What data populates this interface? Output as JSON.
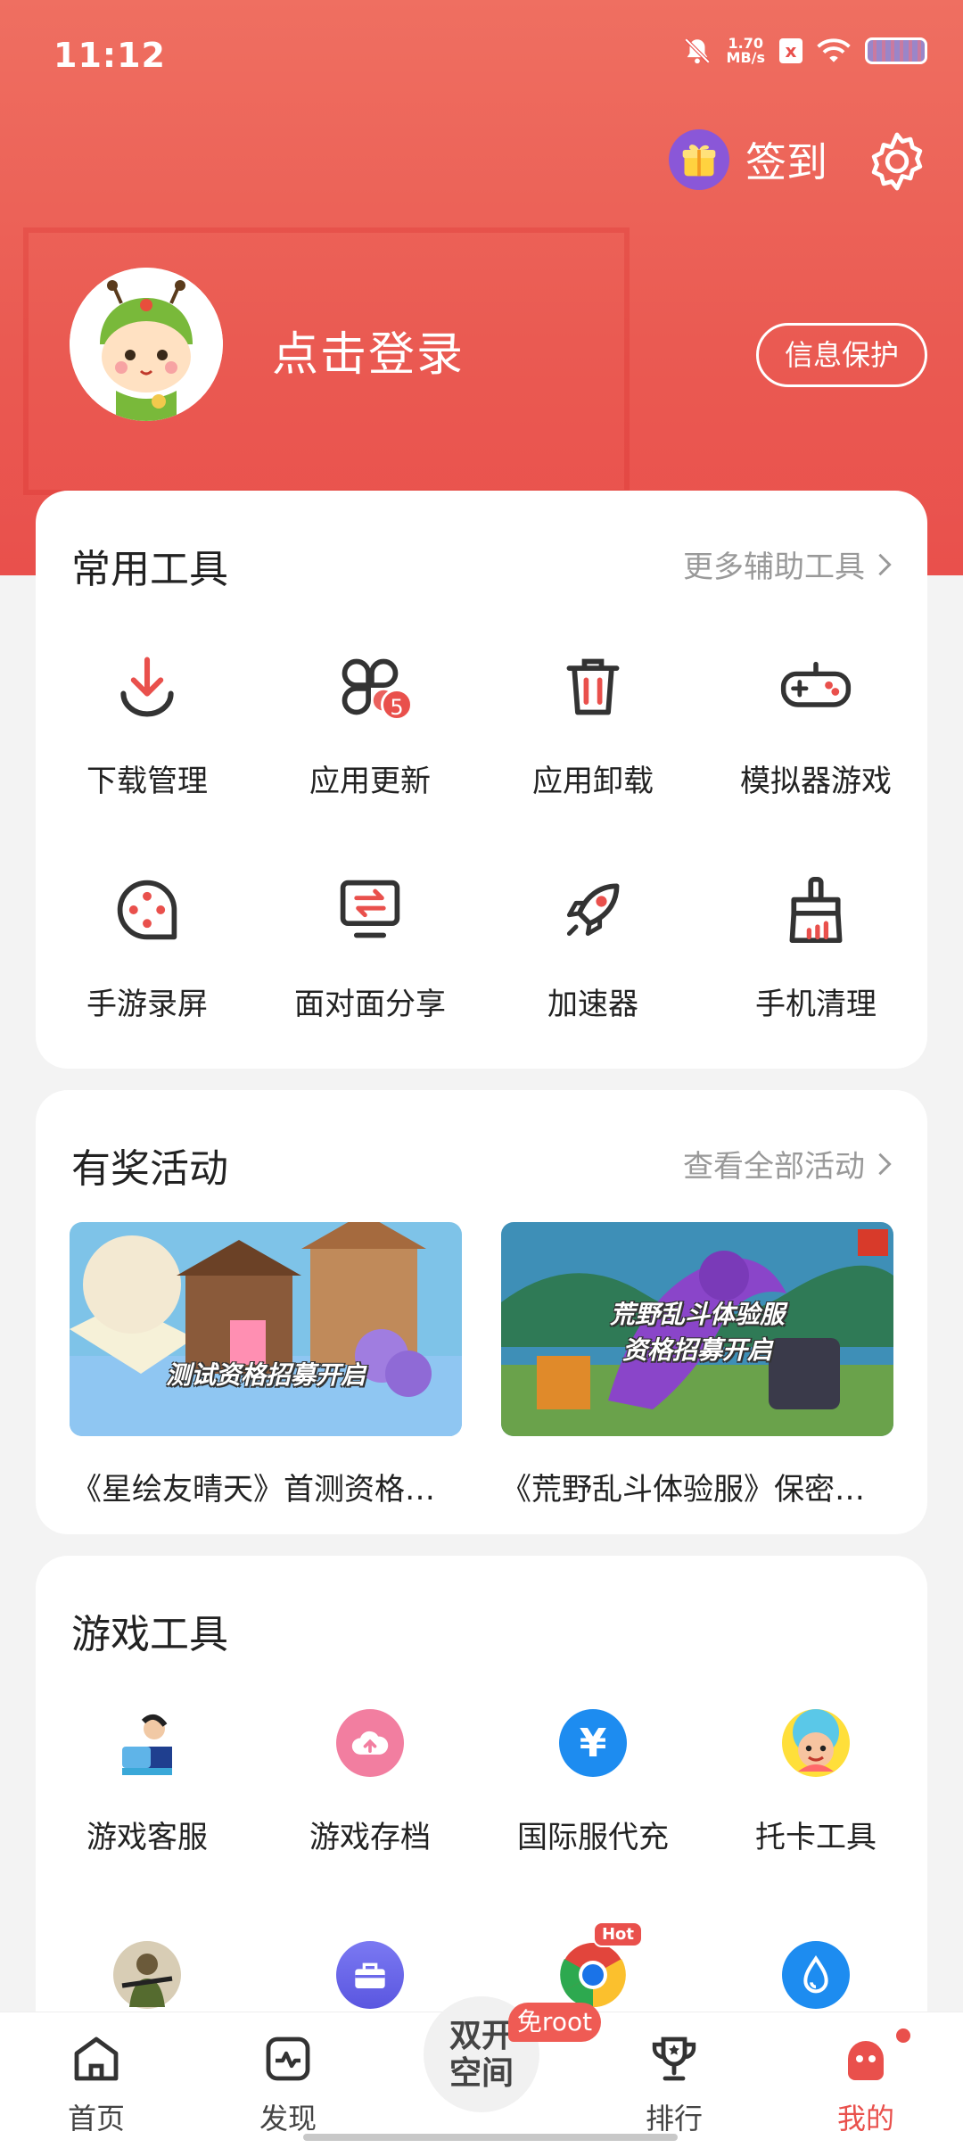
{
  "status_bar": {
    "time": "11:12",
    "net_speed_value": "1.70",
    "net_speed_unit": "MB/s",
    "sim_label": "x"
  },
  "header": {
    "signin_label": "签到",
    "login_label": "点击登录",
    "protect_label": "信息保护"
  },
  "common_tools": {
    "title": "常用工具",
    "more_label": "更多辅助工具",
    "items": [
      {
        "label": "下载管理",
        "icon": "download-icon"
      },
      {
        "label": "应用更新",
        "icon": "apps-update-icon",
        "badge": "5"
      },
      {
        "label": "应用卸载",
        "icon": "trash-icon"
      },
      {
        "label": "模拟器游戏",
        "icon": "gamepad-icon"
      },
      {
        "label": "手游录屏",
        "icon": "screen-record-icon"
      },
      {
        "label": "面对面分享",
        "icon": "share-screen-icon"
      },
      {
        "label": "加速器",
        "icon": "rocket-icon"
      },
      {
        "label": "手机清理",
        "icon": "broom-icon"
      }
    ]
  },
  "activities": {
    "title": "有奖活动",
    "more_label": "查看全部活动",
    "items": [
      {
        "caption": "测试资格招募开启",
        "title": "《星绘友晴天》首测资格…"
      },
      {
        "caption_line1": "荒野乱斗体验服",
        "caption_line2": "资格招募开启",
        "title": "《荒野乱斗体验服》保密…"
      }
    ]
  },
  "game_tools": {
    "title": "游戏工具",
    "items": [
      {
        "label": "游戏客服",
        "icon": "customer-service-icon"
      },
      {
        "label": "游戏存档",
        "icon": "cloud-upload-icon"
      },
      {
        "label": "国际服代充",
        "icon": "yuan-icon",
        "glyph": "¥"
      },
      {
        "label": "托卡工具",
        "icon": "toca-icon"
      }
    ],
    "second_row_icons": [
      "soldier-icon",
      "toolbox-icon",
      "chrome-icon",
      "water-drop-icon"
    ],
    "hot_label": "Hot"
  },
  "tabbar": {
    "tabs": [
      {
        "label": "首页",
        "icon": "home-icon"
      },
      {
        "label": "发现",
        "icon": "discover-icon"
      },
      {
        "label": "排行",
        "icon": "trophy-icon"
      },
      {
        "label": "我的",
        "icon": "profile-icon",
        "active": true
      }
    ],
    "center_line1": "双开",
    "center_line2": "空间",
    "noroot_label": "免root"
  },
  "colors": {
    "accent": "#e9504c",
    "header_top": "#ef6f61"
  }
}
